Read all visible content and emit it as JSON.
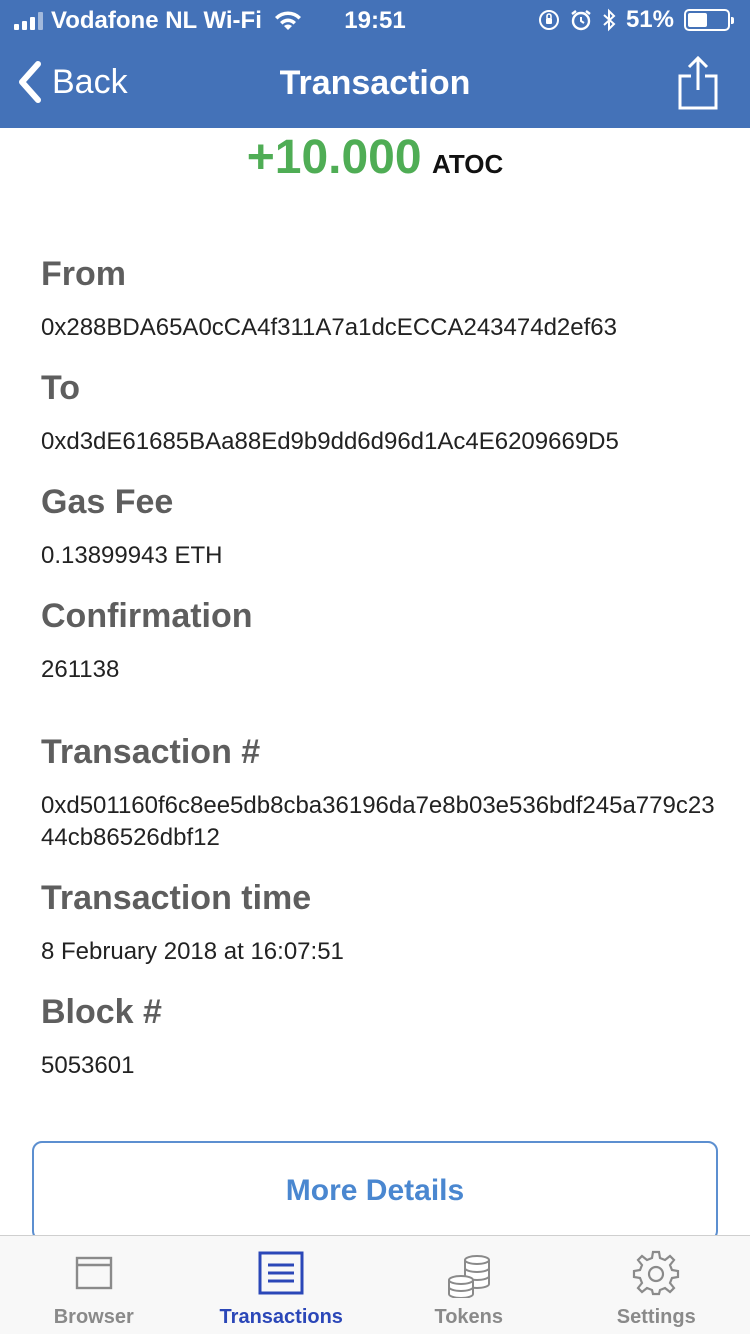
{
  "status_bar": {
    "carrier": "Vodafone NL Wi-Fi",
    "time": "19:51",
    "battery": "51%",
    "battery_level": 0.51
  },
  "nav": {
    "back_label": "Back",
    "title": "Transaction"
  },
  "amount": {
    "value": "+10.000",
    "unit": "ATOC",
    "color": "#4fad55"
  },
  "fields": {
    "from": {
      "label": "From",
      "value": "0x288BDA65A0cCA4f311A7a1dcECCA243474d2ef63"
    },
    "to": {
      "label": "To",
      "value": "0xd3dE61685BAa88Ed9b9dd6d96d1Ac4E6209669D5"
    },
    "gas_fee": {
      "label": "Gas Fee",
      "value": "0.13899943 ETH"
    },
    "confirmation": {
      "label": "Confirmation",
      "value": "261138"
    },
    "tx_hash": {
      "label": "Transaction #",
      "value": "0xd501160f6c8ee5db8cba36196da7e8b03e536bdf245a779c2344cb86526dbf12"
    },
    "tx_time": {
      "label": "Transaction time",
      "value": "8 February 2018 at 16:07:51"
    },
    "block": {
      "label": "Block #",
      "value": "5053601"
    }
  },
  "more_details_label": "More Details",
  "tabs": [
    {
      "label": "Browser",
      "icon": "browser-icon",
      "active": false
    },
    {
      "label": "Transactions",
      "icon": "list-icon",
      "active": true
    },
    {
      "label": "Tokens",
      "icon": "coins-icon",
      "active": false
    },
    {
      "label": "Settings",
      "icon": "gear-icon",
      "active": false
    }
  ],
  "colors": {
    "header_blue": "#4472b8",
    "active_tab": "#2b47b8",
    "button_text": "#4a87d0"
  }
}
